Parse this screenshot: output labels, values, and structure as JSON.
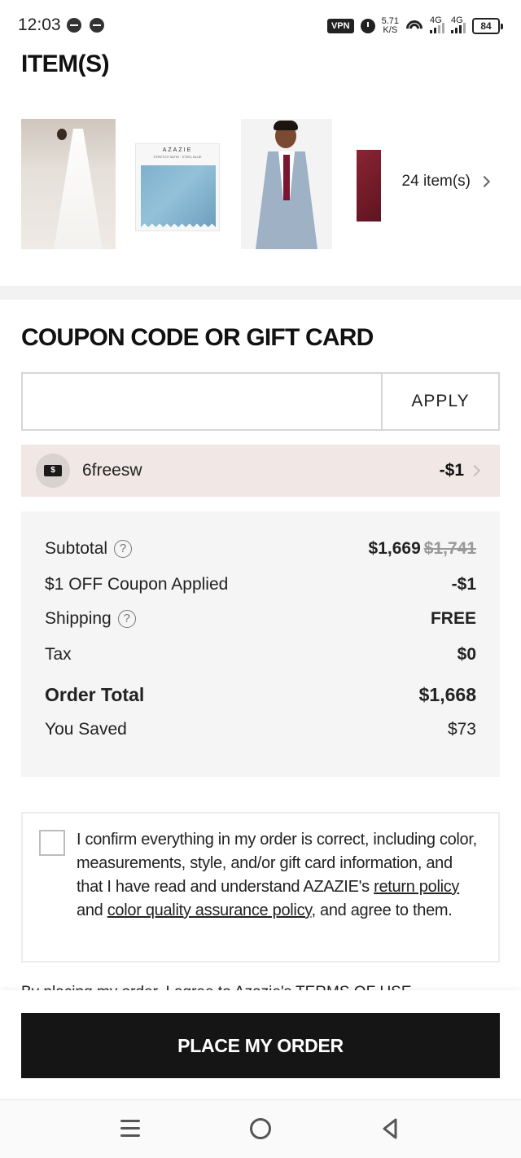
{
  "status_bar": {
    "time": "12:03",
    "vpn": "VPN",
    "speed_value": "5.71",
    "speed_unit": "K/S",
    "net1": "4G",
    "net2": "4G",
    "battery": "84"
  },
  "items": {
    "title": "ITEM(S)",
    "count_label": "24 item(s)",
    "swatch_brand": "AZAZIE",
    "swatch_sub": "STRETCH SATIN · STEEL BLUE"
  },
  "coupon": {
    "title": "COUPON CODE OR GIFT CARD",
    "input_value": "",
    "input_placeholder": "",
    "apply_label": "APPLY",
    "applied_code": "6freesw",
    "applied_amount": "-$1",
    "ticket_glyph": "$"
  },
  "summary": {
    "subtotal_label": "Subtotal",
    "subtotal_value": "$1,669",
    "subtotal_original": "$1,741",
    "coupon_label": "$1 OFF Coupon Applied",
    "coupon_value": "-$1",
    "shipping_label": "Shipping",
    "shipping_value": "FREE",
    "tax_label": "Tax",
    "tax_value": "$0",
    "total_label": "Order Total",
    "total_value": "$1,668",
    "saved_label": "You Saved",
    "saved_value": "$73",
    "help_glyph": "?"
  },
  "confirm": {
    "text_before": "I confirm everything in my order is correct, including color, measurements, style, and/or gift card information, and that I have read and understand AZAZIE's ",
    "return_policy_link": "return policy",
    "text_middle": " and ",
    "color_policy_link": "color quality assurance policy",
    "text_after": ", and agree to them."
  },
  "terms_partial": "By placing my order, I agree to Azazie's TERMS OF USE",
  "place_order_label": "PLACE MY ORDER",
  "colors": {
    "coupon_bg": "#f1e7e4",
    "summary_bg": "#f5f5f5",
    "button_bg": "#151515"
  }
}
